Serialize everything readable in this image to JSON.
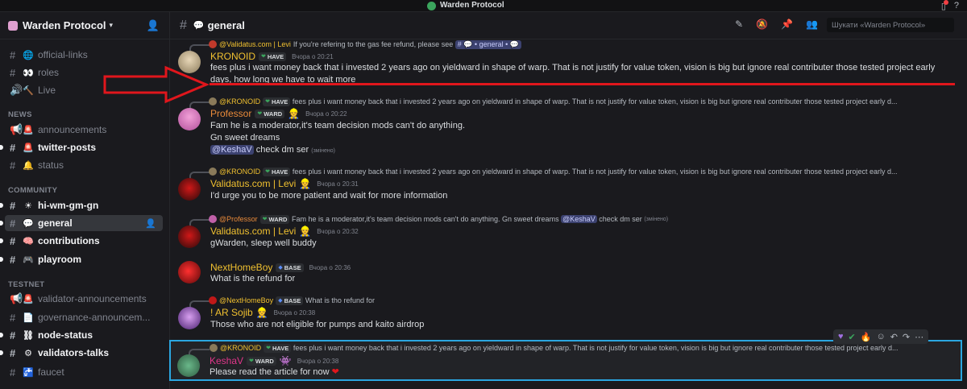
{
  "titlebar": {
    "app_title": "Warden Protocol"
  },
  "server": {
    "name": "Warden Protocol"
  },
  "sidebar": {
    "channels_top": [
      {
        "label": "official-links",
        "icon": "globe-icon"
      },
      {
        "label": "roles",
        "icon": "eyes-icon"
      },
      {
        "label": "Live",
        "icon": "hammer-icon"
      }
    ],
    "category_news": "NEWS",
    "channels_news": [
      {
        "label": "announcements",
        "icon": "siren-icon"
      },
      {
        "label": "twitter-posts",
        "icon": "siren-icon"
      },
      {
        "label": "status",
        "icon": "bell-icon"
      }
    ],
    "category_community": "COMMUNITY",
    "channels_community": [
      {
        "label": "hi-wm-gm-gn",
        "icon": "sun-icon"
      },
      {
        "label": "general",
        "icon": "speech-bubble-icon"
      },
      {
        "label": "contributions",
        "icon": "brain-icon"
      },
      {
        "label": "playroom",
        "icon": "gamepad-icon"
      }
    ],
    "category_testnet": "TESTNET",
    "channels_testnet": [
      {
        "label": "validator-announcements",
        "icon": "siren-icon"
      },
      {
        "label": "governance-announcem...",
        "icon": "document-icon"
      },
      {
        "label": "node-status",
        "icon": "link-icon"
      },
      {
        "label": "validators-talks",
        "icon": "gear-icon"
      },
      {
        "label": "faucet",
        "icon": "faucet-icon"
      }
    ]
  },
  "header": {
    "channel_name": "general",
    "search_placeholder": "Шукати «Warden Protocol»"
  },
  "messages": [
    {
      "reply_name": "@Validatus.com | Levi",
      "reply_text": "If you're refering to the gas fee refund, please see",
      "reply_chip": "# 💬 • general • 💬",
      "author": "KRONOID",
      "author_color": "#f0c030",
      "tag": "HAVE",
      "time": "Вчора о 20:21",
      "body_line1": "fees plus i want money back that i invested 2 years ago on yieldward in shape of warp. That is not justify for value token, vision is big but ignore real contributer those tested project early",
      "body_line2": "days, how long we have to wait more"
    },
    {
      "reply_name": "@KRONOID",
      "reply_tag": "HAVE",
      "reply_text": "fees plus i want money back that i invested 2 years ago on yieldward in shape of warp. That is not justify for value token, vision is big but ignore real contributer those tested project early d...",
      "author": "Professor",
      "author_color": "#e88a3a",
      "tag": "WARD",
      "time": "Вчора о 20:22",
      "body_line1": "Fam he is a moderator,it's team decision mods can't do anything.",
      "body_line2": "Gn sweet dreams",
      "mention": "@KeshaV",
      "body_line3": "check dm ser",
      "edited": "(змінено)"
    },
    {
      "reply_name": "@KRONOID",
      "reply_tag": "HAVE",
      "reply_text": "fees plus i want money back that i invested 2 years ago on yieldward in shape of warp. That is not justify for value token, vision is big but ignore real contributer those tested project early d...",
      "author": "Validatus.com | Levi",
      "author_color": "#f0c030",
      "time": "Вчора о 20:31",
      "body_line1": "I'd urge you to be more patient and wait for more information"
    },
    {
      "reply_name": "@Professor",
      "reply_tag": "WARD",
      "reply_text": "Fam he is a moderator,it's team decision mods can't do anything. Gn sweet dreams",
      "reply_mention": "@KeshaV",
      "reply_text2": "check dm ser",
      "reply_edited": "(змінено)",
      "author": "Validatus.com | Levi",
      "author_color": "#f0c030",
      "time": "Вчора о 20:32",
      "body_line1": "gWarden, sleep well buddy"
    },
    {
      "author": "NextHomeBoy",
      "author_color": "#f0c030",
      "tag": "BASE",
      "time": "Вчора о 20:36",
      "body_line1": "What is the refund for"
    },
    {
      "reply_name": "@NextHomeBoy",
      "reply_tag": "BASE",
      "reply_text": "What is tho refund for",
      "author": "! AR Sojib",
      "author_color": "#f0c030",
      "time": "Вчора о 20:38",
      "body_line1": "Those who are not eligible for pumps and kaito airdrop"
    },
    {
      "reply_name": "@KRONOID",
      "reply_tag": "HAVE",
      "reply_text": "fees plus i want money back that i invested 2 years ago on yieldward in shape of warp. That is not justify for value token, vision is big but ignore real contributer those tested project early d...",
      "author": "KeshaV",
      "author_color": "#e0368a",
      "tag": "WARD",
      "time": "Вчора о 20:38",
      "body_line1": "Please read the article for now"
    }
  ]
}
